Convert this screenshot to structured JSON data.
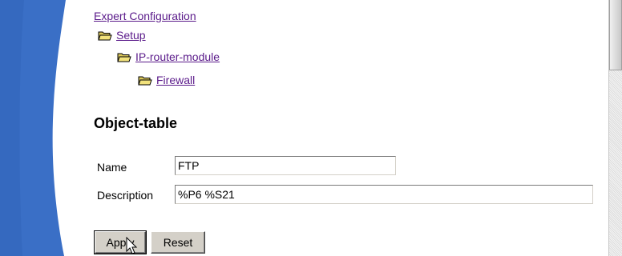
{
  "breadcrumb": {
    "root": "Expert Configuration",
    "level1": "Setup",
    "level2": "IP-router-module",
    "level3": "Firewall"
  },
  "page_title": "Object-table",
  "form": {
    "name_label": "Name",
    "name_value": "FTP",
    "description_label": "Description",
    "description_value": "%P6 %S21"
  },
  "buttons": {
    "apply": "Apply",
    "reset": "Reset"
  },
  "icons": {
    "folder": "folder-open-icon",
    "cursor": "mouse-pointer-icon"
  },
  "colors": {
    "link": "#5a1a8a",
    "left_band_blue": "#3a6fc6",
    "folder_yellow": "#e8d66a"
  }
}
